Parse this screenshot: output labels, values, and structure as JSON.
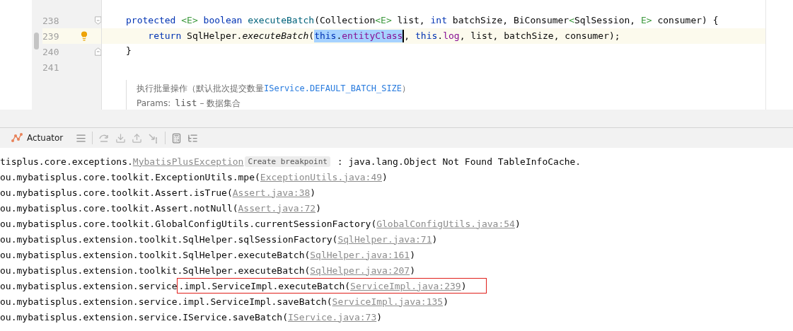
{
  "editor": {
    "lines": [
      {
        "number": "238",
        "current": false,
        "fold_start": true,
        "fold_end": false,
        "bulb": false,
        "tokens": [
          {
            "text": "protected ",
            "kind": "keyword"
          },
          {
            "text": "<E> ",
            "kind": "generic"
          },
          {
            "text": "boolean ",
            "kind": "keyword"
          },
          {
            "text": "executeBatch",
            "kind": "declaration"
          },
          {
            "text": "(Collection",
            "kind": "plain"
          },
          {
            "text": "<E>",
            "kind": "generic"
          },
          {
            "text": " list, ",
            "kind": "plain"
          },
          {
            "text": "int",
            "kind": "keyword"
          },
          {
            "text": " batchSize, BiConsumer",
            "kind": "plain"
          },
          {
            "text": "<",
            "kind": "generic"
          },
          {
            "text": "SqlSession, ",
            "kind": "plain"
          },
          {
            "text": "E>",
            "kind": "generic"
          },
          {
            "text": " consumer) {",
            "kind": "plain"
          }
        ]
      },
      {
        "number": "239",
        "current": true,
        "fold_start": false,
        "fold_end": false,
        "bulb": true,
        "tokens": [
          {
            "text": "    return",
            "kind": "keyword"
          },
          {
            "text": " SqlHelper.",
            "kind": "plain"
          },
          {
            "text": "executeBatch",
            "kind": "static"
          },
          {
            "text": "(",
            "kind": "plain"
          },
          {
            "kind": "selection",
            "parts": [
              {
                "text": "this",
                "kind": "keyword"
              },
              {
                "text": ".",
                "kind": "plain"
              },
              {
                "text": "entityClass",
                "kind": "field"
              }
            ]
          },
          {
            "text": ", ",
            "kind": "plain"
          },
          {
            "text": "this",
            "kind": "keyword"
          },
          {
            "text": ".",
            "kind": "plain"
          },
          {
            "text": "log",
            "kind": "field"
          },
          {
            "text": ", list, batchSize, consumer);",
            "kind": "plain"
          }
        ]
      },
      {
        "number": "240",
        "current": false,
        "fold_start": false,
        "fold_end": true,
        "bulb": false,
        "tokens": [
          {
            "text": "}",
            "kind": "plain"
          }
        ]
      },
      {
        "number": "241",
        "current": false,
        "fold_start": false,
        "fold_end": false,
        "bulb": false
      }
    ],
    "doc": {
      "description": [
        {
          "text": "执行批量操作（默认批次提交数量",
          "kind": "text"
        },
        {
          "text": "IService.DEFAULT_BATCH_SIZE",
          "kind": "link"
        },
        {
          "text": "）",
          "kind": "text"
        }
      ],
      "params_label": "Params:",
      "param_name": "list",
      "param_desc": "– 数据集合"
    }
  },
  "toolbar": {
    "tab": {
      "label": "Actuator"
    }
  },
  "console": {
    "lines": [
      {
        "segments": [
          {
            "text": "tisplus.core.exceptions.",
            "kind": "text",
            "boxed": false
          },
          {
            "text": "MybatisPlusException",
            "kind": "link",
            "boxed": false
          },
          {
            "text": "Create breakpoint",
            "kind": "hint",
            "boxed": false
          },
          {
            "text": " : java.lang.Object Not Found TableInfoCache.",
            "kind": "text",
            "boxed": false
          }
        ]
      },
      {
        "segments": [
          {
            "text": "ou.mybatisplus.core.toolkit.ExceptionUtils.mpe(",
            "kind": "text",
            "boxed": false
          },
          {
            "text": "ExceptionUtils.java:49",
            "kind": "link",
            "boxed": false
          },
          {
            "text": ")",
            "kind": "text",
            "boxed": false
          }
        ]
      },
      {
        "segments": [
          {
            "text": "ou.mybatisplus.core.toolkit.Assert.isTrue(",
            "kind": "text",
            "boxed": false
          },
          {
            "text": "Assert.java:38",
            "kind": "link",
            "boxed": false
          },
          {
            "text": ")",
            "kind": "text",
            "boxed": false
          }
        ]
      },
      {
        "segments": [
          {
            "text": "ou.mybatisplus.core.toolkit.Assert.notNull(",
            "kind": "text",
            "boxed": false
          },
          {
            "text": "Assert.java:72",
            "kind": "link",
            "boxed": false
          },
          {
            "text": ")",
            "kind": "text",
            "boxed": false
          }
        ]
      },
      {
        "segments": [
          {
            "text": "ou.mybatisplus.core.toolkit.GlobalConfigUtils.currentSessionFactory(",
            "kind": "text",
            "boxed": false
          },
          {
            "text": "GlobalConfigUtils.java:54",
            "kind": "link",
            "boxed": false
          },
          {
            "text": ")",
            "kind": "text",
            "boxed": false
          }
        ]
      },
      {
        "segments": [
          {
            "text": "ou.mybatisplus.extension.toolkit.SqlHelper.sqlSessionFactory(",
            "kind": "text",
            "boxed": false
          },
          {
            "text": "SqlHelper.java:71",
            "kind": "link",
            "boxed": false
          },
          {
            "text": ")",
            "kind": "text",
            "boxed": false
          }
        ]
      },
      {
        "segments": [
          {
            "text": "ou.mybatisplus.extension.toolkit.SqlHelper.executeBatch(",
            "kind": "text",
            "boxed": false
          },
          {
            "text": "SqlHelper.java:161",
            "kind": "link",
            "boxed": false
          },
          {
            "text": ")",
            "kind": "text",
            "boxed": false
          }
        ]
      },
      {
        "segments": [
          {
            "text": "ou.mybatisplus.extension.toolkit.SqlHelper.executeBatch(",
            "kind": "text",
            "boxed": false
          },
          {
            "text": "SqlHelper.java:207",
            "kind": "link",
            "boxed": false
          },
          {
            "text": ")",
            "kind": "text",
            "boxed": false
          }
        ]
      },
      {
        "segments": [
          {
            "text": "ou.mybatisplus.extension.service",
            "kind": "text",
            "boxed": false
          },
          {
            "text": ".impl.ServiceImpl.executeBatch(",
            "kind": "text",
            "boxed": true
          },
          {
            "text": "ServiceImpl.java:239",
            "kind": "link",
            "boxed": true
          },
          {
            "text": ")",
            "kind": "text",
            "boxed": true
          }
        ]
      },
      {
        "segments": [
          {
            "text": "ou.mybatisplus.extension.service.impl.ServiceImpl.saveBatch(",
            "kind": "text",
            "boxed": false
          },
          {
            "text": "ServiceImpl.java:135",
            "kind": "link",
            "boxed": false
          },
          {
            "text": ")",
            "kind": "text",
            "boxed": false
          }
        ]
      },
      {
        "segments": [
          {
            "text": "ou.mybatisplus.extension.service.IService.saveBatch(",
            "kind": "text",
            "boxed": false
          },
          {
            "text": "IService.java:73",
            "kind": "link",
            "boxed": false
          },
          {
            "text": ")",
            "kind": "text",
            "boxed": false
          }
        ]
      }
    ]
  }
}
